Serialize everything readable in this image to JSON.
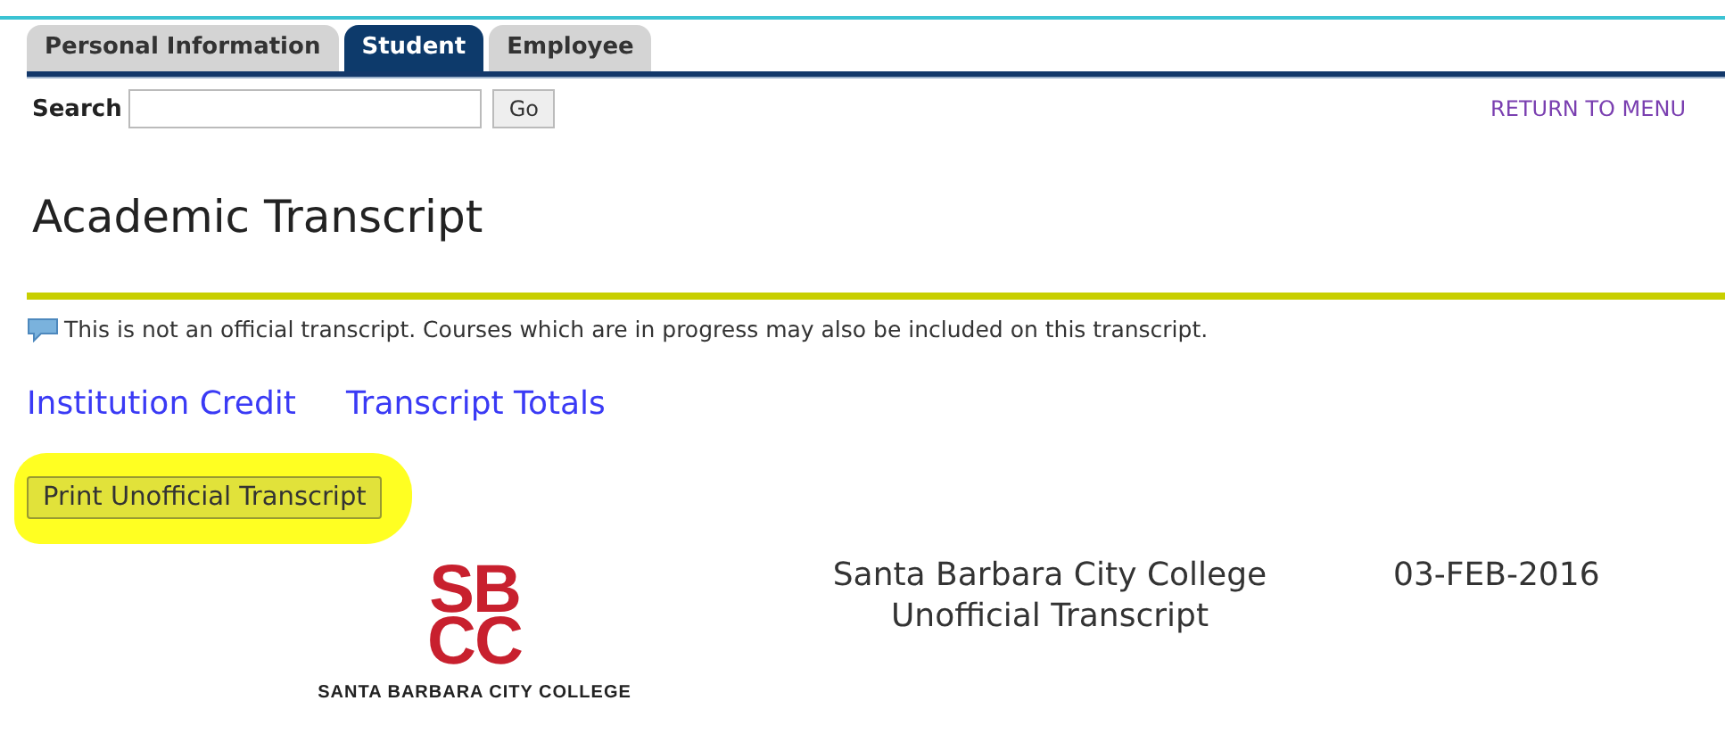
{
  "tabs": [
    {
      "label": "Personal Information",
      "selected": false
    },
    {
      "label": "Student",
      "selected": true
    },
    {
      "label": "Employee",
      "selected": false
    }
  ],
  "search": {
    "label": "Search",
    "button": "Go"
  },
  "return_link": "RETURN TO MENU",
  "title": "Academic Transcript",
  "info": "This is not an official transcript. Courses which are in progress may also be included on this transcript.",
  "links": [
    "Institution Credit",
    "Transcript Totals"
  ],
  "print_button": {
    "label": "Print Unofficial Transcript",
    "highlighted": true
  },
  "report_header": {
    "logo_lines": [
      "SB",
      "CC"
    ],
    "logo_caption": "SANTA BARBARA CITY COLLEGE",
    "college": "Santa Barbara City College",
    "document": "Unofficial Transcript",
    "date": "03-FEB-2016"
  }
}
